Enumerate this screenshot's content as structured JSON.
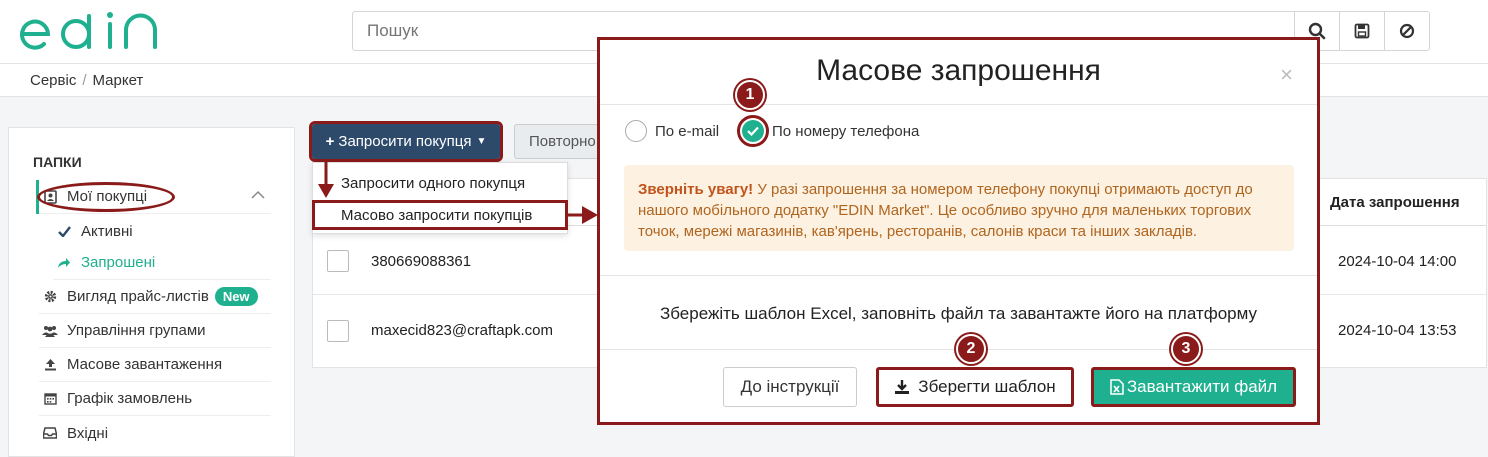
{
  "search": {
    "placeholder": "Пошук"
  },
  "breadcrumb": {
    "service": "Сервіс",
    "separator": "/",
    "market": "Маркет"
  },
  "sidebar": {
    "title": "ПАПКИ",
    "items": [
      {
        "label": "Мої покупці"
      },
      {
        "label": "Активні"
      },
      {
        "label": "Запрошені"
      },
      {
        "label": "Вигляд прайс-листів",
        "badge": "New"
      },
      {
        "label": "Управління групами"
      },
      {
        "label": "Масове завантаження"
      },
      {
        "label": "Графік замовлень"
      },
      {
        "label": "Вхідні"
      }
    ]
  },
  "toolbar": {
    "invite_label": "Запросити покупця",
    "repeat_label": "Повторно"
  },
  "dropdown": {
    "items": [
      {
        "label": "Запросити одного покупця"
      },
      {
        "label": "Масово запросити покупців"
      }
    ]
  },
  "table": {
    "date_header": "Дата запрошення",
    "rows": [
      {
        "contact": "380669088361",
        "date": "2024-10-04 14:00"
      },
      {
        "contact": "maxecid823@craftapk.com",
        "date": "2024-10-04 13:53"
      }
    ]
  },
  "modal": {
    "title": "Масове запрошення",
    "close": "×",
    "radio_email": "По e-mail",
    "radio_phone": "По номеру телефона",
    "alert_strong": "Зверніть увагу!",
    "alert_text": " У разі запрошення за номером телефону покупці отримають доступ до нашого мобільного додатку \"EDIN Market\". Це особливо зручно для маленьких торгових точок, мережі магазинів, кав'ярень, ресторанів, салонів краси та інших закладів.",
    "instruction_text": "Збережіть шаблон Excel, заповніть файл та завантажте його на платформу",
    "btn_instructions": "До інструкції",
    "btn_save_template": "Зберегти шаблон",
    "btn_upload_file": "Завантажити файл"
  },
  "markers": [
    "1",
    "2",
    "3"
  ],
  "colors": {
    "accent": "#1fb08f",
    "navy": "#2d4a6b",
    "highlight": "#8b1a1a",
    "alert_bg": "#fdf1e2",
    "alert_text": "#b0651e"
  }
}
